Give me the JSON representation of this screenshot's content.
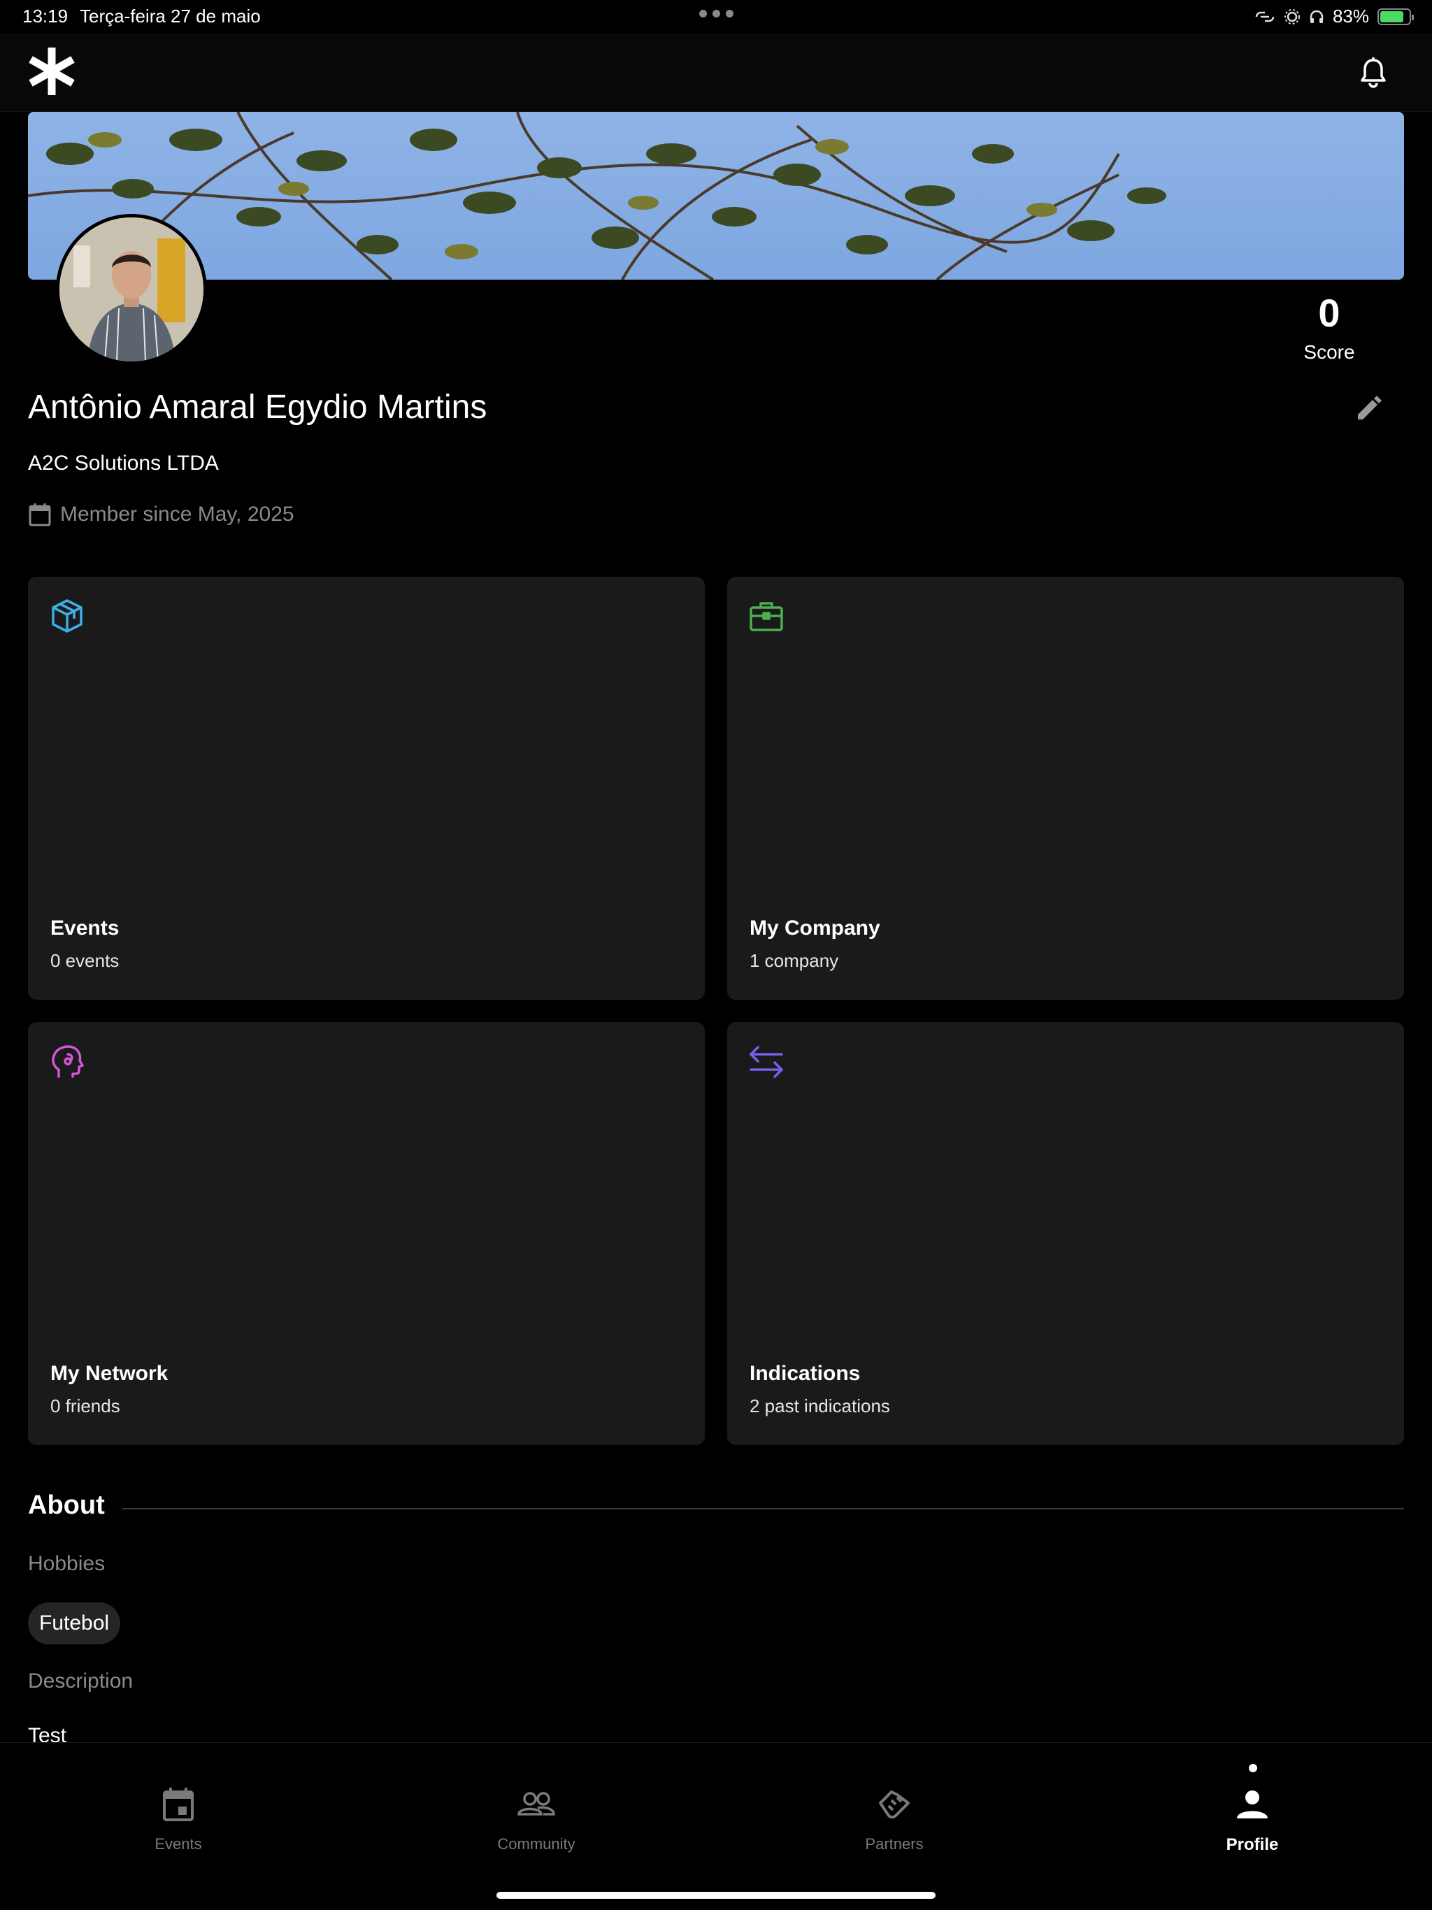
{
  "status_bar": {
    "time": "13:19",
    "date": "Terça-feira 27 de maio",
    "battery": "83%"
  },
  "header": {
    "logo_icon": "asterisk-logo",
    "notification_icon": "bell-icon"
  },
  "profile": {
    "name": "Antônio Amaral Egydio Martins",
    "company": "A2C Solutions LTDA",
    "member_since": "Member since May, 2025",
    "score_value": "0",
    "score_label": "Score"
  },
  "cards": [
    {
      "title": "Events",
      "subtitle": "0 events",
      "icon": "cube-icon",
      "color": "#3ab0e8"
    },
    {
      "title": "My Company",
      "subtitle": "1 company",
      "icon": "briefcase-icon",
      "color": "#4caf50"
    },
    {
      "title": "My Network",
      "subtitle": "0 friends",
      "icon": "head-icon",
      "color": "#d356d8"
    },
    {
      "title": "Indications",
      "subtitle": "2 past indications",
      "icon": "arrows-icon",
      "color": "#7c5cf0"
    }
  ],
  "about": {
    "title": "About",
    "hobbies_label": "Hobbies",
    "hobbies": [
      "Futebol"
    ],
    "description_label": "Description",
    "description": "Test"
  },
  "tabs": [
    {
      "label": "Events",
      "icon": "calendar-icon",
      "active": false
    },
    {
      "label": "Community",
      "icon": "people-icon",
      "active": false
    },
    {
      "label": "Partners",
      "icon": "handshake-icon",
      "active": false
    },
    {
      "label": "Profile",
      "icon": "person-icon",
      "active": true
    }
  ]
}
